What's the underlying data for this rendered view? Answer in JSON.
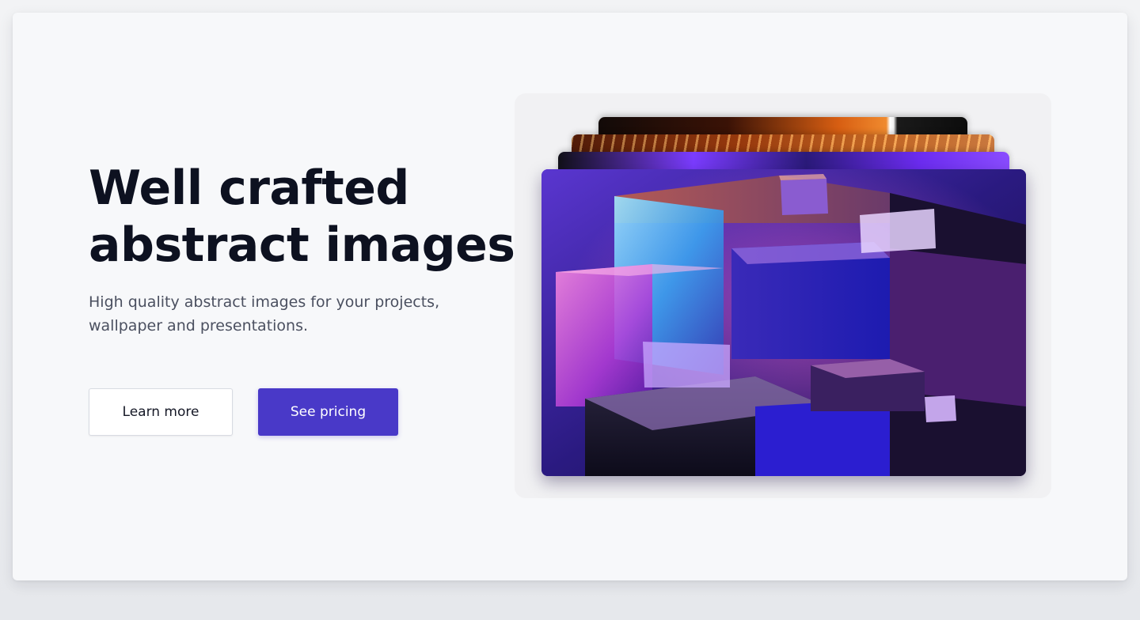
{
  "hero": {
    "title_line1": "Well crafted",
    "title_line2": "abstract images",
    "subtitle_line1": "High quality abstract images for your projects,",
    "subtitle_line2": "wallpaper and presentations."
  },
  "actions": {
    "learn_more_label": "Learn more",
    "see_pricing_label": "See pricing"
  },
  "colors": {
    "primary": "#4939c8",
    "title_text": "#0d1120",
    "subtitle_text": "#4b5060",
    "card_background": "#f7f8fa"
  }
}
